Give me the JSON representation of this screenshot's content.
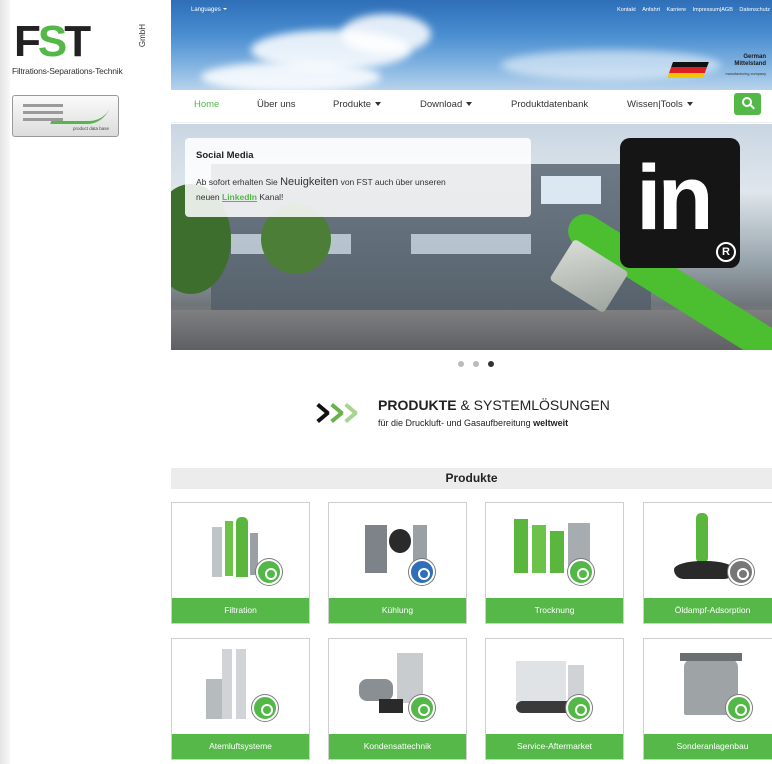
{
  "brand": {
    "logo_letters": "FST",
    "gmbh": "GmbH",
    "tagline": "Filtrations-Separations-Technik",
    "product_data_base_caption": "product data base"
  },
  "header": {
    "languages": "Languages",
    "top_links": [
      "Kontakt",
      "Anfahrt",
      "Karriere",
      "Impressum|AGB",
      "Datenschutz"
    ],
    "mittelstand_line1": "German",
    "mittelstand_line2": "Mittelstand",
    "mittelstand_sub": "manufacturing company"
  },
  "nav": {
    "items": [
      "Home",
      "Über uns",
      "Produkte",
      "Download",
      "Produktdatenbank",
      "Wissen|Tools"
    ]
  },
  "hero": {
    "card_title": "Social Media",
    "card_text_1": "Ab sofort erhalten Sie ",
    "card_text_big": "Neuigkeiten",
    "card_text_2": " von FST auch über unseren",
    "card_text_3": "neuen ",
    "card_link": "LinkedIn",
    "card_text_4": " Kanal!",
    "logo_text": "in",
    "reg_mark": "R",
    "slides": 3,
    "active_slide": 3
  },
  "intro": {
    "headline_bold": "PRODUKTE",
    "headline_rest": " & SYSTEMLÖSUNGEN",
    "subline_pre": "für die Druckluft- und Gasaufbereitung ",
    "subline_bold": "weltweit"
  },
  "products": {
    "section_title": "Produkte",
    "tiles": [
      "Filtration",
      "Kühlung",
      "Trocknung",
      "Öldampf-Adsorption",
      "Atemluftsysteme",
      "Kondensattechnik",
      "Service-Aftermarket",
      "Sonderanlagenbau"
    ]
  },
  "colors": {
    "brand_green": "#53b848",
    "sky_blue": "#2e6fb8",
    "linkedin_black": "#151515"
  }
}
